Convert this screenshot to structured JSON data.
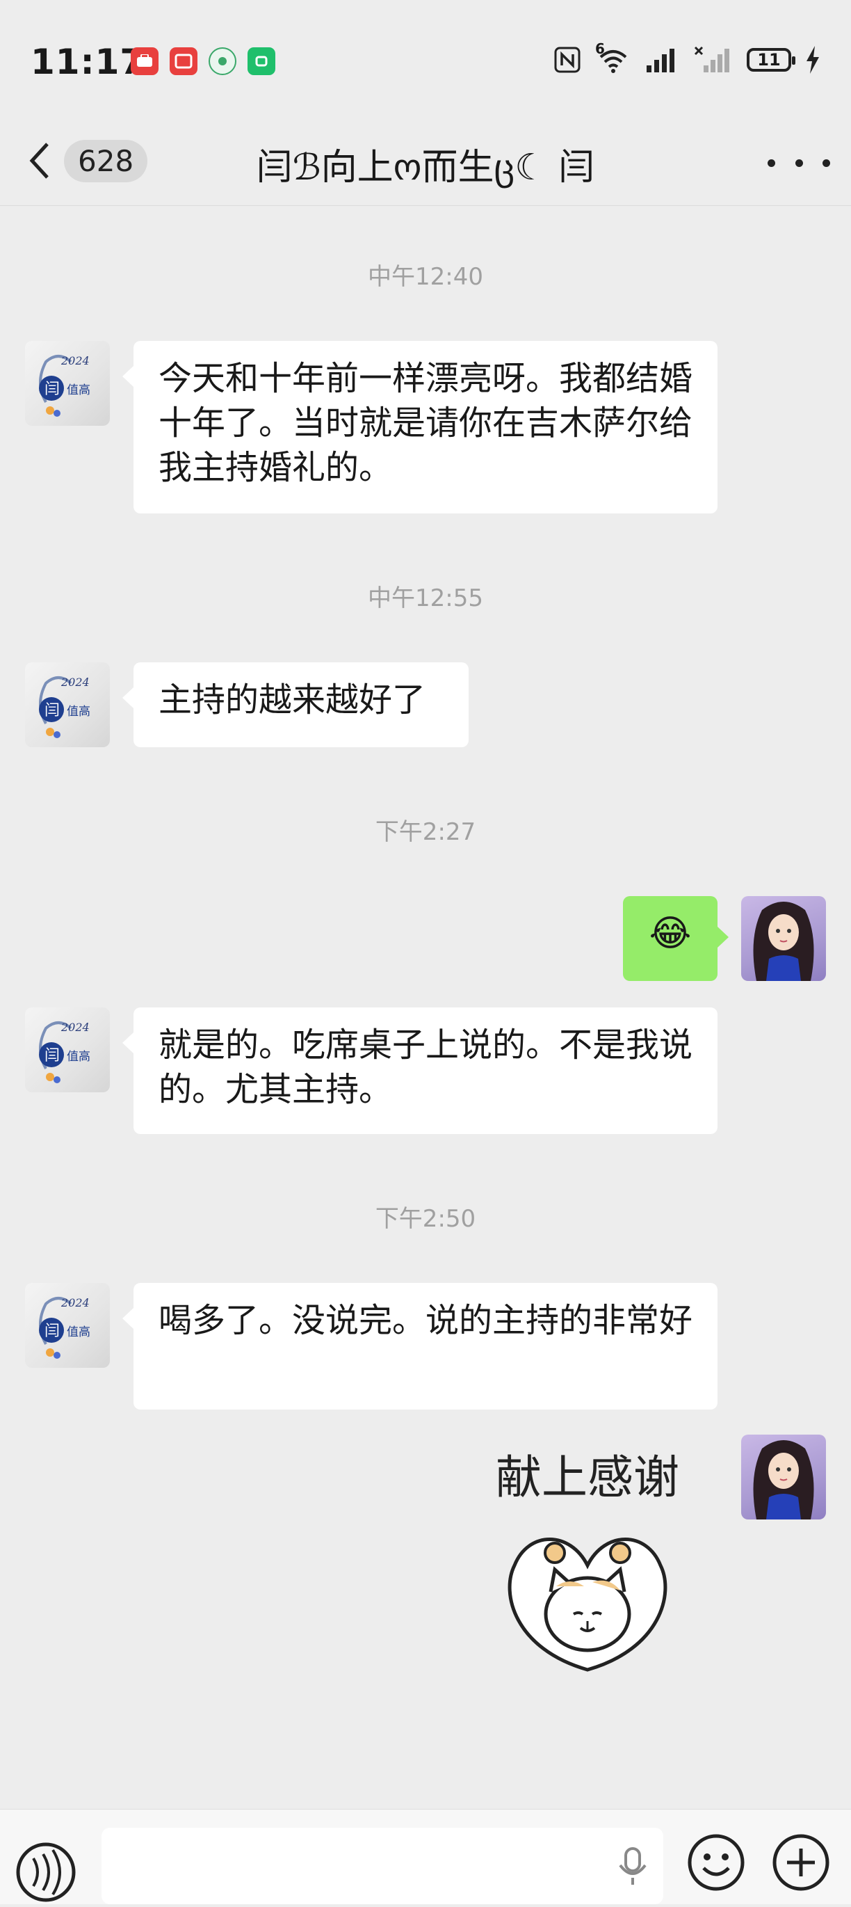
{
  "status_bar": {
    "time": "11:17",
    "battery": "11",
    "network": "6"
  },
  "header": {
    "back_count": "628",
    "title": "闫ℬ向上ო而生ც☾ 闫"
  },
  "messages": [
    {
      "type": "timestamp",
      "text": "中午12:40"
    },
    {
      "type": "incoming",
      "text": "今天和十年前一样漂亮呀。我都结婚十年了。当时就是请你在吉木萨尔给我主持婚礼的。"
    },
    {
      "type": "timestamp",
      "text": "中午12:55"
    },
    {
      "type": "incoming",
      "text": "主持的越来越好了"
    },
    {
      "type": "timestamp",
      "text": "下午2:27"
    },
    {
      "type": "outgoing",
      "text": "😂"
    },
    {
      "type": "incoming",
      "text": "就是的。吃席桌子上说的。不是我说的。尤其主持。"
    },
    {
      "type": "timestamp",
      "text": "下午2:50"
    },
    {
      "type": "incoming",
      "text": "喝多了。没说完。说的主持的非常好"
    },
    {
      "type": "outgoing-sticker",
      "text": "献上感谢"
    }
  ],
  "avatar_left": {
    "year": "2024",
    "char": "闫",
    "caption": "值高"
  },
  "colors": {
    "background": "#ededed",
    "incoming_bubble": "#ffffff",
    "outgoing_bubble": "#95ec69",
    "timestamp": "#a0a0a0"
  },
  "icons": [
    "back-chevron-icon",
    "more-icon",
    "voice-icon",
    "mic-icon",
    "emoji-icon",
    "plus-icon"
  ]
}
